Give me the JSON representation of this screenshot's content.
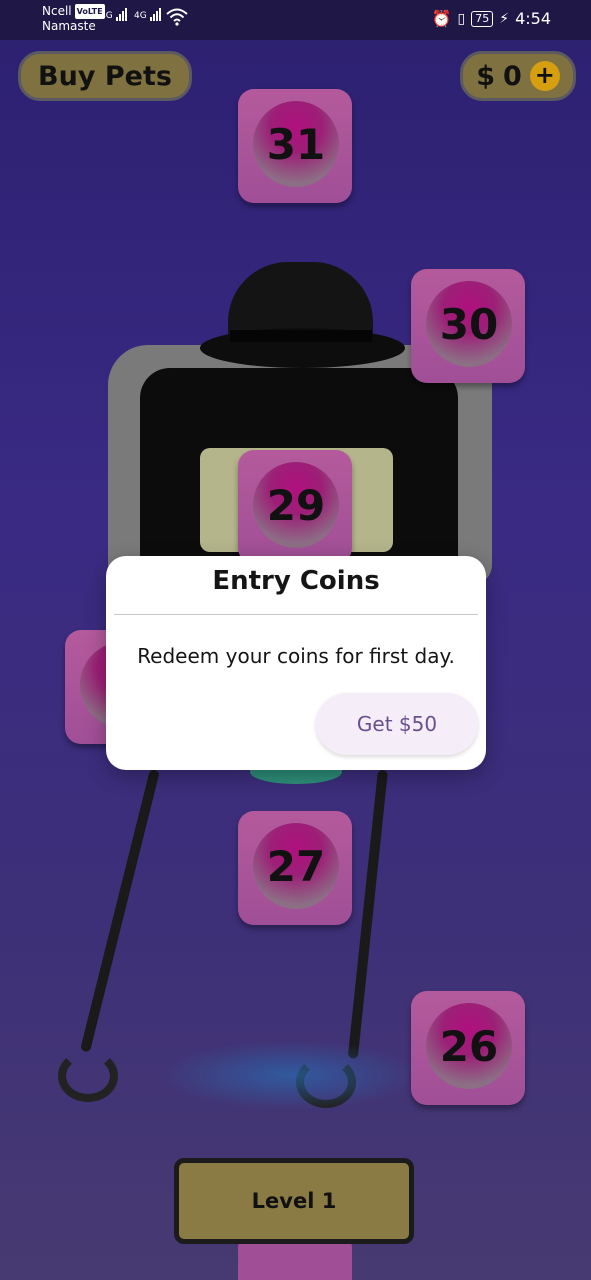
{
  "status_bar": {
    "carrier": "Ncell",
    "volte": "VoLTE",
    "network_label": "Namaste",
    "signal1": "4G",
    "signal2": "4G",
    "battery": "75",
    "time": "4:54"
  },
  "header": {
    "buy_pets_label": "Buy Pets",
    "currency_symbol": "$",
    "coin_balance": "0",
    "add_coins_symbol": "+"
  },
  "levels": {
    "tiles": [
      "31",
      "30",
      "29",
      "27",
      "26",
      "2"
    ]
  },
  "footer": {
    "current_level_label": "Level 1"
  },
  "dialog": {
    "title": "Entry Coins",
    "message": "Redeem your coins for first day.",
    "button_label": "Get $50"
  }
}
